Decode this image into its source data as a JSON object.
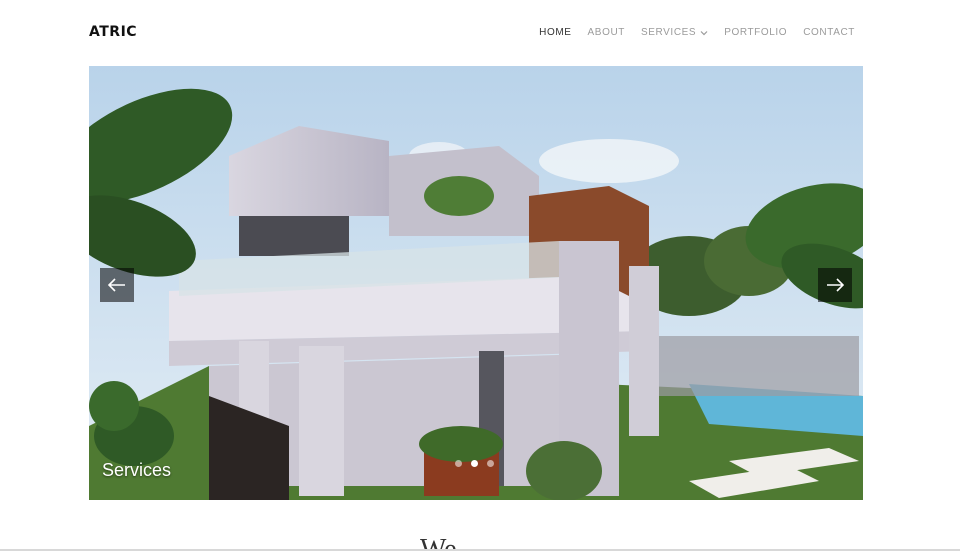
{
  "header": {
    "logo": "ATRIC",
    "nav": [
      {
        "label": "HOME",
        "active": true
      },
      {
        "label": "ABOUT",
        "active": false
      },
      {
        "label": "SERVICES",
        "active": false,
        "has_dropdown": true
      },
      {
        "label": "PORTFOLIO",
        "active": false
      },
      {
        "label": "CONTACT",
        "active": false
      }
    ]
  },
  "slider": {
    "caption": "Services",
    "prev_icon": "arrow-left-icon",
    "next_icon": "arrow-right-icon",
    "slide_count": 3,
    "active_slide": 2
  },
  "section": {
    "title": "We"
  },
  "colors": {
    "accent": "#111111",
    "nav_inactive": "#9b9b9b",
    "sky": "#c7dcee",
    "lawn": "#4f7a32",
    "pool": "#5fb6d8"
  }
}
